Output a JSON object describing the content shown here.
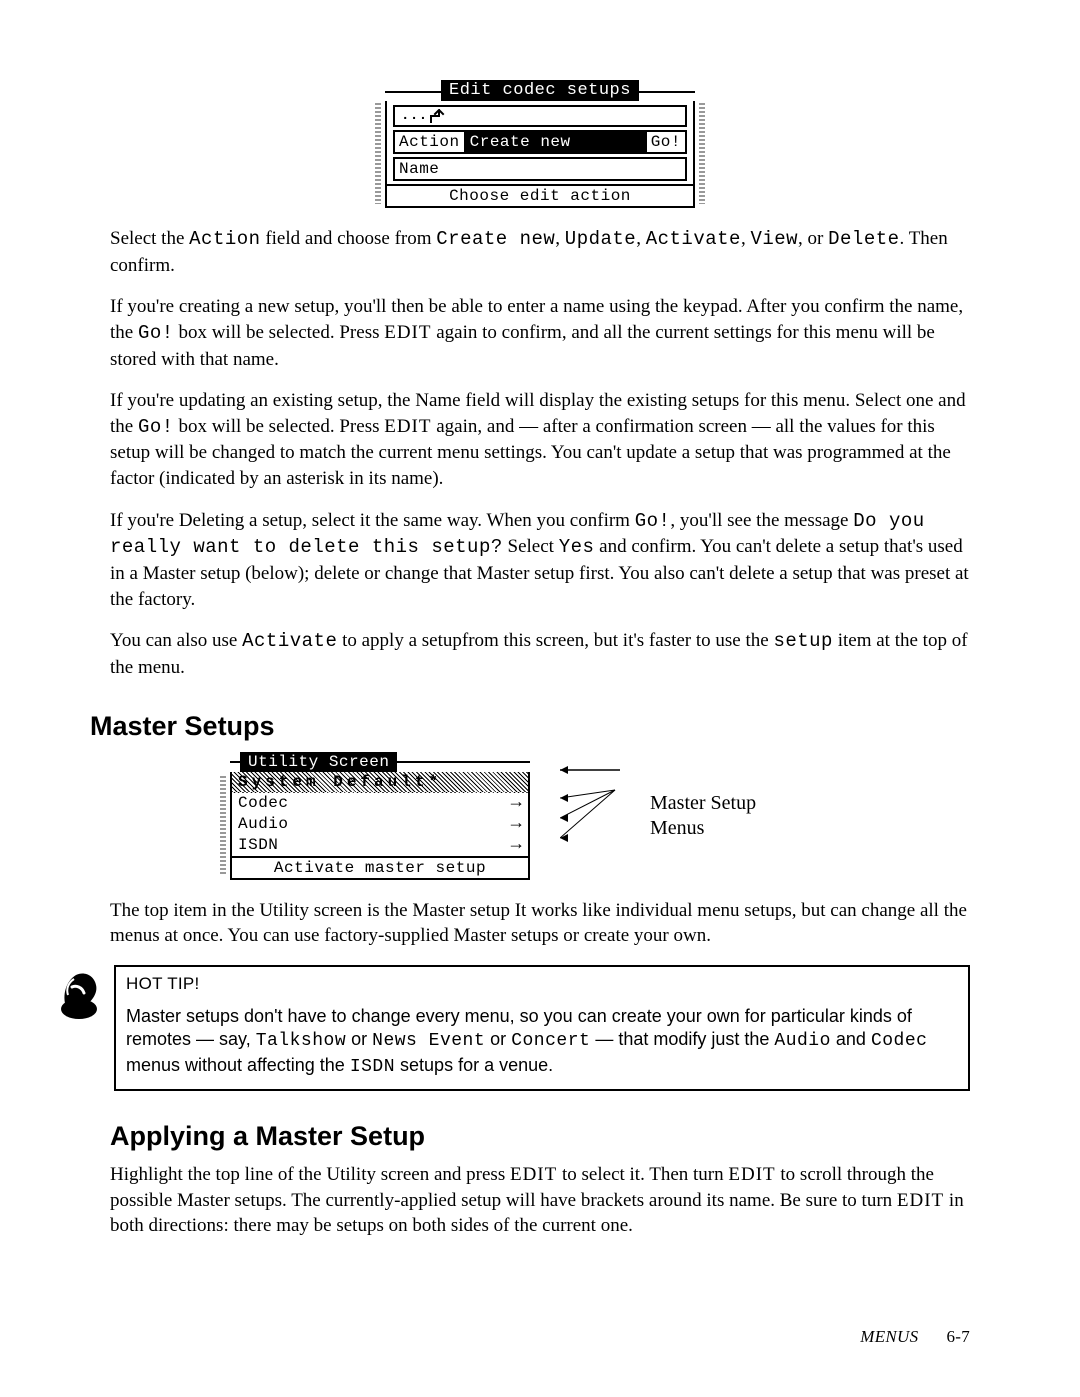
{
  "lcd1": {
    "title": "Edit codec setups",
    "up_dots": "...",
    "action_label": "Action",
    "action_value": "Create new",
    "go_label": "Go!",
    "name_label": "Name",
    "footer": "Choose edit action"
  },
  "p1": {
    "a": "Select the ",
    "b": "Action",
    "c": " field and choose from ",
    "d": "Create new",
    "e": ", ",
    "f": "Update",
    "g": ", ",
    "h": "Activate",
    "i": ", ",
    "j": "View",
    "k": ",  or  ",
    "l": "Delete",
    "m": ". Then  confirm."
  },
  "p2": {
    "a": "If you're creating a new setup, you'll then be able to enter a name using the keypad. After you confirm the name, the ",
    "b": "Go!",
    "c": " box will be selected. Press ",
    "d": "EDIT",
    "e": " again to confirm, and all the current settings for this menu will be stored with that name."
  },
  "p3": {
    "a": "If you're updating an existing setup, the Name field will display the existing setups for this menu. Select one and the ",
    "b": "Go!",
    "c": " box will be selected. Press ",
    "d": "EDIT",
    "e": " again, and — after a confirmation screen — all the values for this setup will be changed to match the current menu settings. You can't update a setup that was programmed at the factor (indicated by an asterisk in its name)."
  },
  "p4": {
    "a": "If you're Deleting a setup, select it the same way. When you confirm ",
    "b": "Go!",
    "c": ", you'll see the message ",
    "d": "Do you really want to delete this setup?",
    "e": " Select ",
    "f": "Yes",
    "g": " and confirm. You can't delete a setup that's used in a Master setup (below); delete or change that Master setup first. You also can't delete a setup that was preset at the factory."
  },
  "p5": {
    "a": "You can also use ",
    "b": "Activate",
    "c": " to apply a setupfrom this screen, but it's faster to use the ",
    "d": "setup",
    "e": " item at the top of the menu."
  },
  "h_master": "Master Setups",
  "lcd2": {
    "title": "Utility Screen",
    "row_hl": "System Default*",
    "rows": [
      "Codec",
      "Audio",
      "ISDN"
    ],
    "footer": "Activate master setup"
  },
  "annot": {
    "l1": "Master Setup",
    "l2": "Menus"
  },
  "p6": "The top item in the Utility screen is the Master setup It works like individual menu setups, but can change all the menus at once. You can use factory-supplied Master setups or create your own.",
  "tip": {
    "label": "HOT TIP!",
    "a": "Master setups don't have to change every menu, so you can create your own for particular kinds of remotes — say, ",
    "b": "Talkshow",
    "c": " or ",
    "d": "News Event",
    "e": " or ",
    "f": "Concert",
    "g": " — that modify just the ",
    "h": "Audio",
    "i": " and ",
    "j": "Codec",
    "k": " menus without affecting the ",
    "l": "ISDN",
    "m": " setups for a venue."
  },
  "h_apply": "Applying a Master Setup",
  "p7": {
    "a": "Highlight the top line of the Utility screen and press ",
    "b": "EDIT",
    "c": " to select it. Then turn ",
    "d": "EDIT",
    "e": " to scroll through the possible Master setups. The currently-applied setup will have brackets around its name. Be sure to turn ",
    "f": "EDIT",
    "g": " in both directions: there may be setups on both sides of the current one."
  },
  "footer": {
    "section": "MENUS",
    "page": "6-7"
  }
}
